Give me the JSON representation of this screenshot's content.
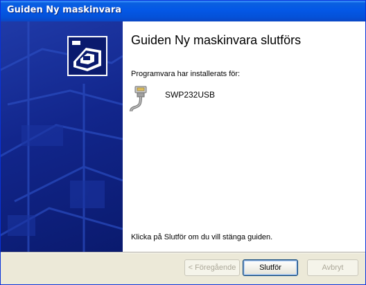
{
  "window": {
    "title": "Guiden Ny maskinvara"
  },
  "content": {
    "heading": "Guiden Ny maskinvara slutförs",
    "installed_label": "Programvara har installerats för:",
    "device_name": "SWP232USB",
    "device_icon": "usb-serial-cable-icon",
    "finish_text": "Klicka på Slutför om du vill stänga guiden."
  },
  "buttons": {
    "back": "< Föregående",
    "finish": "Slutför",
    "cancel": "Avbryt"
  },
  "colors": {
    "titlebar": "#0458e6",
    "side_panel": "#12268c",
    "dialog_bg": "#ece9d8"
  }
}
